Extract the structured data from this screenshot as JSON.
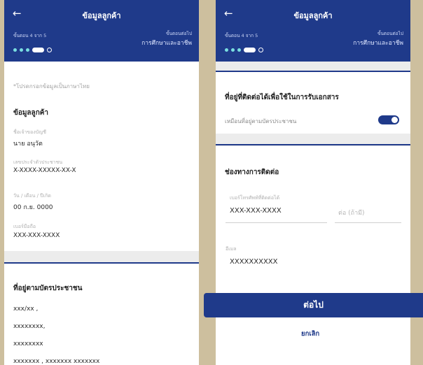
{
  "left": {
    "header": {
      "back_icon": "back-arrow-icon",
      "title": "ข้อมูลลูกค้า",
      "step": "ขั้นตอน 4 จาก 5",
      "next_label": "ขั้นตอนต่อไป",
      "next_value": "การศึกษาและอาชีพ",
      "progress_current": 4,
      "progress_total": 5
    },
    "note": "*โปรดกรอกข้อมูลเป็นภาษาไทย",
    "section_customer": {
      "title": "ข้อมูลลูกค้า",
      "fields": [
        {
          "label": "ชื่อเจ้าของบัญชี",
          "value": "นาย อนุวัต"
        },
        {
          "label": "เลขประจำตัวประชาชน",
          "value": "X-XXXX-XXXXX-XX-X"
        },
        {
          "label": "วัน / เดือน / ปีเกิด",
          "value": "00 ก.ย. 0000"
        },
        {
          "label": "เบอร์มือถือ",
          "value": "XXX-XXX-XXXX"
        }
      ]
    },
    "section_address": {
      "title": "ที่อยู่ตามบัตรประชาชน",
      "lines": [
        "xxx/xx ,",
        "xxxxxxxx,",
        "xxxxxxxx",
        "xxxxxxx , xxxxxxx xxxxxxx"
      ]
    }
  },
  "right": {
    "header": {
      "back_icon": "back-arrow-icon",
      "title": "ข้อมูลลูกค้า",
      "step": "ขั้นตอน 4 จาก 5",
      "next_label": "ขั้นตอนต่อไป",
      "next_value": "การศึกษาและอาชีพ",
      "progress_current": 4,
      "progress_total": 5
    },
    "section_contact_address": {
      "title": "ที่อยู่ที่ติดต่อได้เพื่อใช้ในการรับเอกสาร",
      "toggle_label": "เหมือนที่อยู่ตามบัตรประชาชน",
      "toggle_on": true
    },
    "section_contact": {
      "title": "ช่องทางการติดต่อ",
      "phone_label": "เบอร์โทรศัพท์ที่ติดต่อได้",
      "phone_value": "XXX-XXX-XXXX",
      "ext_placeholder": "ต่อ (ถ้ามี)",
      "email_label": "อีเมล",
      "email_value": "XXXXXXXXXX"
    },
    "next_button": "ต่อไป",
    "cancel_button": "ยกเลิก"
  },
  "colors": {
    "brand": "#1f3a8a",
    "progress_dot": "#7adfe0",
    "background": "#cdbf9e"
  }
}
